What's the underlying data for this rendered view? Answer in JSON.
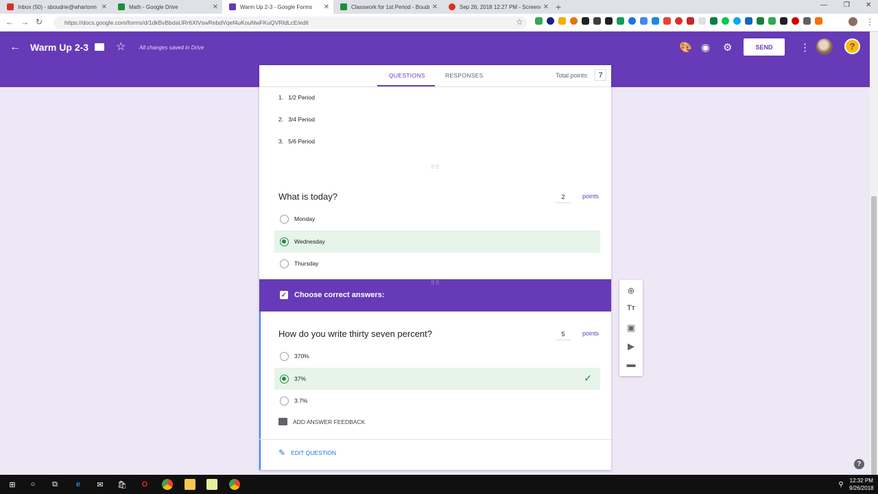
{
  "browser": {
    "tabs": [
      {
        "title": "Inbox (50) - sboudrie@whartonn",
        "fav_color": "#d93025"
      },
      {
        "title": "Math - Google Drive",
        "fav_color": "#1e8e3e"
      },
      {
        "title": "Warm Up 2-3 - Google Forms",
        "fav_color": "#673ab7"
      },
      {
        "title": "Classwork for 1st Period - Boudri",
        "fav_color": "#1e8e3e"
      },
      {
        "title": "Sep 26, 2018 12:27 PM - Screenc",
        "fav_color": "#d93025"
      }
    ],
    "new_tab": "+",
    "url": "https://docs.google.com/forms/d/1dkBvBbdaURr6XlVswRebdVqef4uKouNwFKuQVRldLcE/edit"
  },
  "header": {
    "title": "Warm Up 2-3",
    "saved_status": "All changes saved in Drive",
    "send_label": "SEND",
    "help_glyph": "?"
  },
  "form_tabs": {
    "questions": "QUESTIONS",
    "responses": "RESPONSES",
    "total_points_label": "Total points:",
    "total_points_value": "7"
  },
  "period_list": [
    {
      "num": "1.",
      "label": "1/2 Period"
    },
    {
      "num": "2.",
      "label": "3/4 Period"
    },
    {
      "num": "3.",
      "label": "5/6 Period"
    }
  ],
  "question_today": {
    "title": "What is today?",
    "points": "2",
    "points_label": "points",
    "options": [
      "Monday",
      "Wednesday",
      "Thursday"
    ],
    "correct_index": 1
  },
  "answer_key": {
    "header": "Choose correct answers:"
  },
  "question_percent": {
    "title": "How do you write thirty seven percent?",
    "points": "5",
    "points_label": "points",
    "options": [
      "370%",
      "37%",
      "3.7%"
    ],
    "correct_index": 1,
    "feedback_label": "ADD ANSWER FEEDBACK",
    "edit_label": "EDIT QUESTION"
  },
  "taskbar": {
    "time": "12:32 PM",
    "date": "9/26/2018"
  },
  "colors": {
    "brand": "#673ab7",
    "correct": "#1e8e3e",
    "correct_bg": "#e6f4ea",
    "page_bg": "#ede7f6"
  }
}
